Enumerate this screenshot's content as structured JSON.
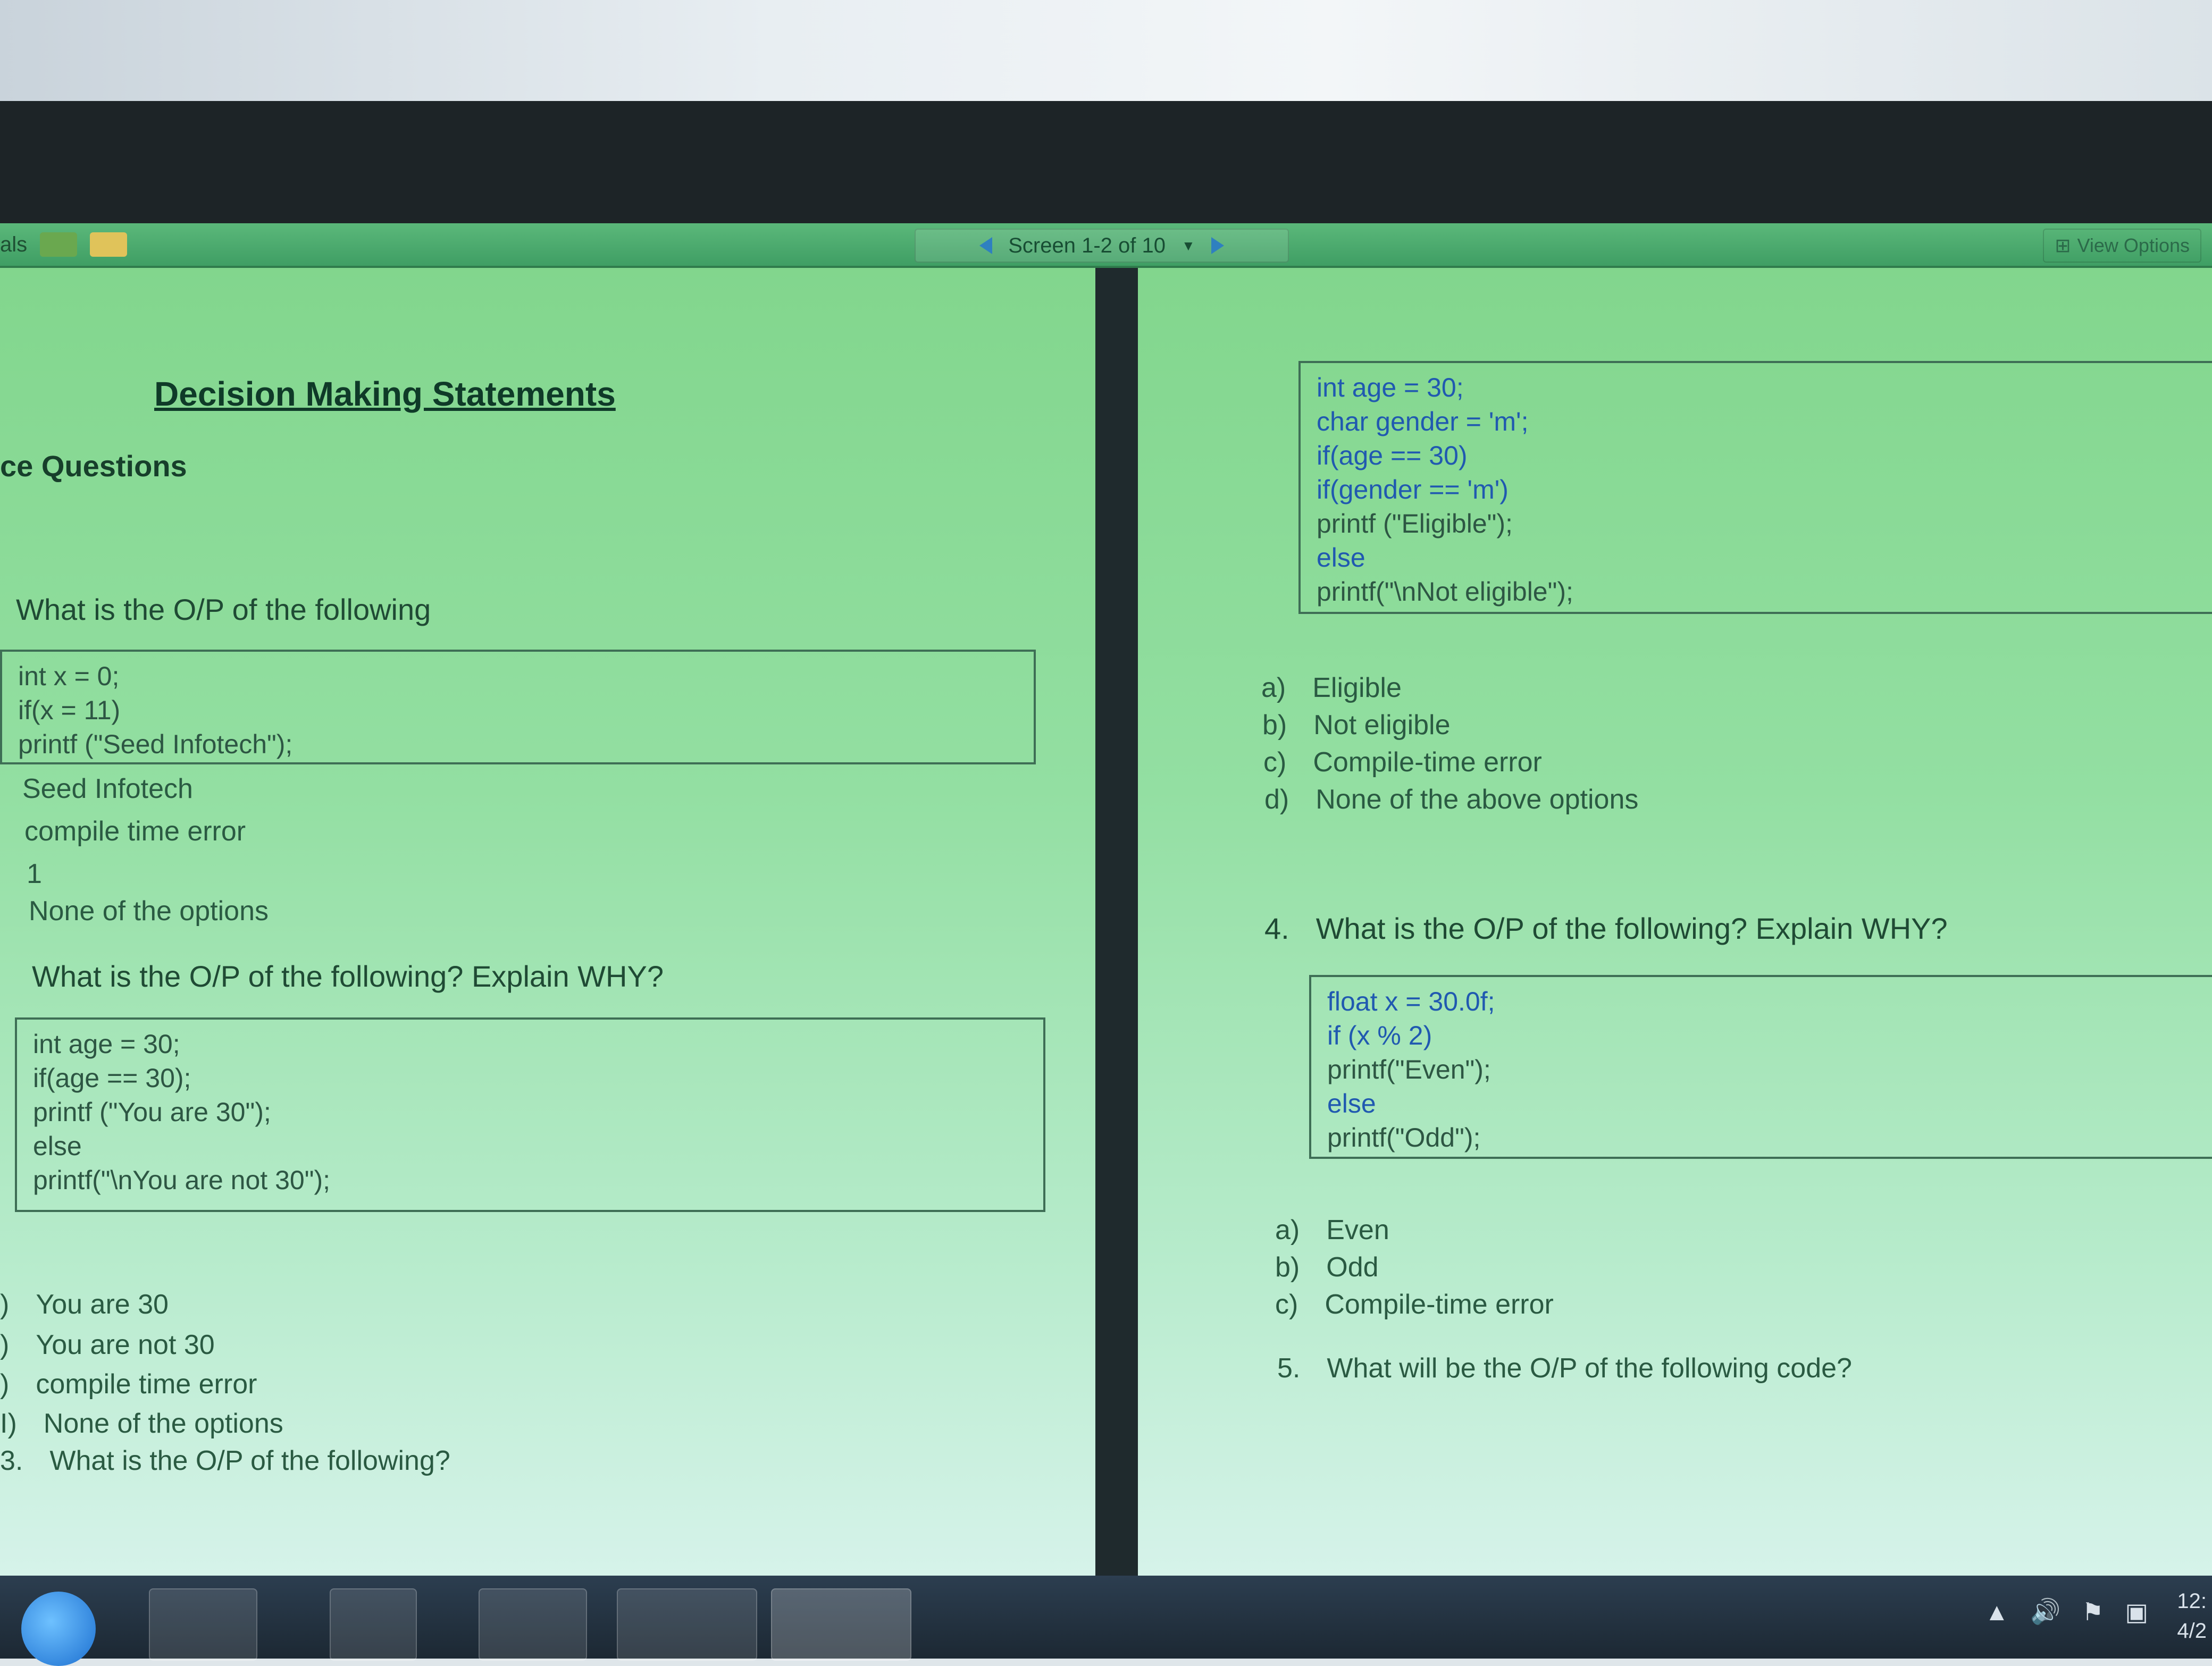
{
  "toolbar": {
    "left_label": "als",
    "screen_label": "Screen 1-2 of 10",
    "view_options": "View Options"
  },
  "left_page": {
    "heading": "Decision Making Statements",
    "subheading": "ce Questions",
    "q1": {
      "question": "What is the O/P of the following",
      "code": [
        "int x = 0;",
        "if(x = 11)",
        "printf (\"Seed Infotech\");"
      ],
      "options": [
        "Seed Infotech",
        "compile time error",
        "1",
        "None of the options"
      ]
    },
    "q2": {
      "question": "What is the O/P of the following? Explain WHY?",
      "code": [
        "int age = 30;",
        "if(age == 30);",
        "printf (\"You are 30\");",
        "else",
        "printf(\"\\nYou are not 30\");"
      ],
      "options": [
        {
          "letter": ")",
          "text": "You are 30"
        },
        {
          "letter": ")",
          "text": "You are not 30"
        },
        {
          "letter": ")",
          "text": "compile time error"
        },
        {
          "letter": "I)",
          "text": "None of the options"
        }
      ]
    },
    "q3": {
      "number": "3.",
      "question": "What is the O/P of the following?"
    }
  },
  "right_page": {
    "code_top": [
      "int age = 30;",
      "char gender = 'm';",
      "if(age == 30)",
      "if(gender == 'm')",
      "printf (\"Eligible\");",
      "else",
      "printf(\"\\nNot eligible\");"
    ],
    "q3_options": [
      {
        "letter": "a)",
        "text": "Eligible"
      },
      {
        "letter": "b)",
        "text": "Not eligible"
      },
      {
        "letter": "c)",
        "text": "Compile-time error"
      },
      {
        "letter": "d)",
        "text": "None of the above options"
      }
    ],
    "q4": {
      "number": "4.",
      "question": "What is the O/P of the following? Explain WHY?",
      "code": [
        "float x = 30.0f;",
        "if (x % 2)",
        "printf(\"Even\");",
        "else",
        "printf(\"Odd\");"
      ],
      "options": [
        {
          "letter": "a)",
          "text": "Even"
        },
        {
          "letter": "b)",
          "text": "Odd"
        },
        {
          "letter": "c)",
          "text": "Compile-time error"
        }
      ]
    },
    "q5": {
      "number": "5.",
      "question": "What will be the O/P of the following code?"
    }
  },
  "taskbar": {
    "clock_time": "12:",
    "clock_date": "4/2"
  }
}
